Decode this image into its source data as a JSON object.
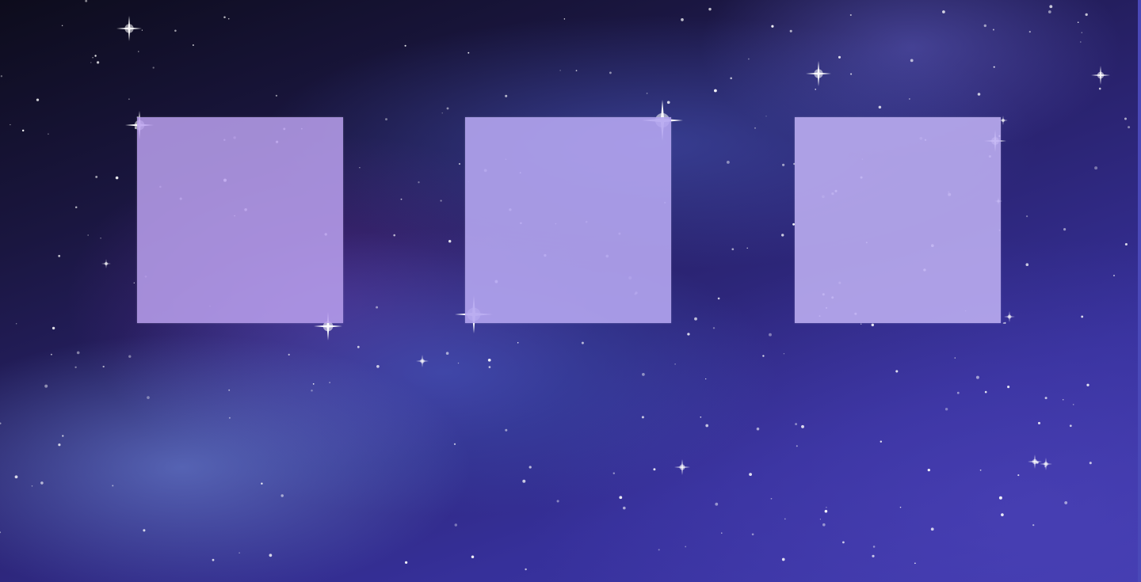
{
  "scene": {
    "background": "galaxy-night-sky",
    "colors": {
      "sky_dark": "#0d0c1c",
      "sky_mid": "#2a2370",
      "sky_light": "#3f39ac",
      "nebula_blue": "#4a60c8",
      "panel_lavender": "#b9a6ee"
    }
  },
  "panels": [
    {
      "name": "content-tile-1"
    },
    {
      "name": "content-tile-2"
    },
    {
      "name": "content-tile-3"
    }
  ]
}
